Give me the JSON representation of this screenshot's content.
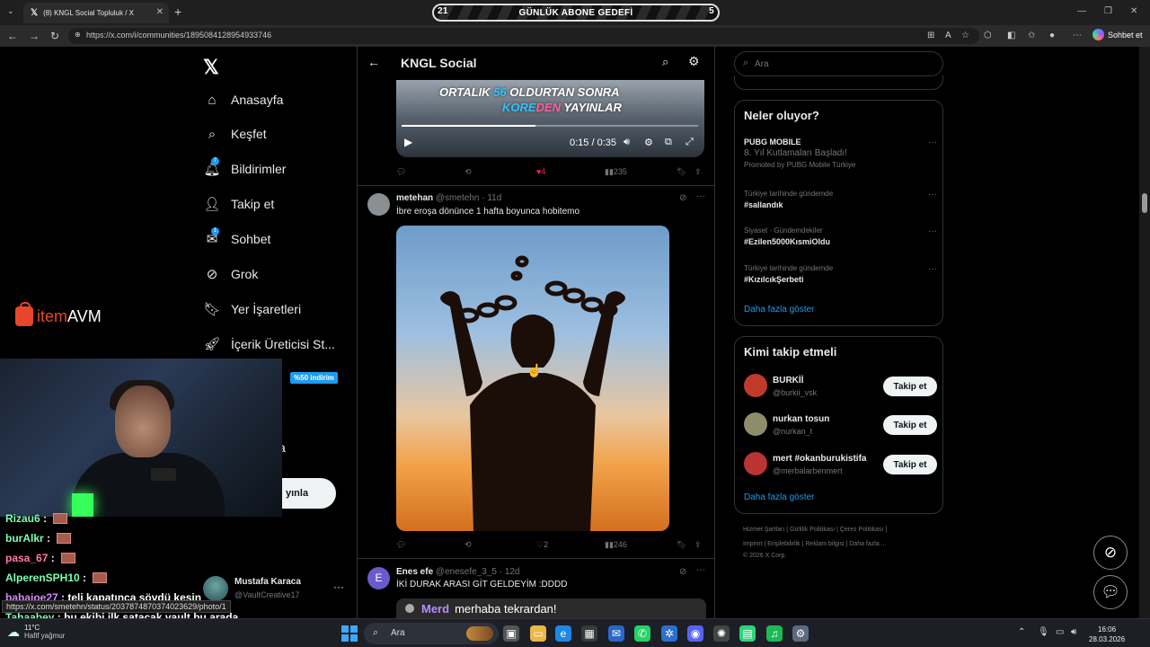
{
  "browser": {
    "tab_title": "(8) KNGL Social Topluluk / X",
    "url": "https://x.com/i/communities/1895084128954933746",
    "copilot_label": "Sohbet et"
  },
  "goal_bar": {
    "label": "GÜNLÜK ABONE GEDEFİ",
    "current": "21",
    "target": "5"
  },
  "nav": {
    "items": [
      {
        "label": "Anasayfa",
        "icon": "home-icon"
      },
      {
        "label": "Keşfet",
        "icon": "search-icon"
      },
      {
        "label": "Bildirimler",
        "icon": "bell-icon",
        "badge": "7"
      },
      {
        "label": "Takip et",
        "icon": "add-person-icon"
      },
      {
        "label": "Sohbet",
        "icon": "mail-icon",
        "badge": "1"
      },
      {
        "label": "Grok",
        "icon": "grok-icon"
      },
      {
        "label": "Yer İşaretleri",
        "icon": "bookmark-icon"
      },
      {
        "label": "İçerik Üreticisi St...",
        "icon": "rocket-icon"
      }
    ],
    "discount_badge": "%50 indirim",
    "partial_item": "a",
    "post_button": "yınla"
  },
  "profile": {
    "name": "Mustafa Karaca",
    "handle": "@VaultCreative17"
  },
  "overlay": {
    "brand_prefix": "item",
    "brand_suffix": "AVM",
    "chat": [
      {
        "user": "Rizau6",
        "msg": "",
        "user_color": "#7cffb0",
        "emote": true
      },
      {
        "user": "burAlkr",
        "msg": "",
        "user_color": "#7cffb0",
        "emote": true
      },
      {
        "user": "pasa_67",
        "msg": "",
        "user_color": "#ff7aa8",
        "emote": true
      },
      {
        "user": "AlperenSPH10",
        "msg": "",
        "user_color": "#7cffb0",
        "emote": true
      },
      {
        "user": "babajoe27",
        "msg": "teli kapatınca sövdü kesin",
        "user_color": "#d58bff",
        "emote": false
      },
      {
        "user": "Tahaabey",
        "msg": "bu ekibi ilk satacak vault bu arada",
        "user_color": "#7cffb0",
        "emote": false
      }
    ],
    "status_url": "https://x.com/smetehn/status/2037874870374023629/photo/1"
  },
  "community": {
    "title": "KNGL Social",
    "video": {
      "line1_a": "ORTALIK ",
      "line1_hi": "56",
      "line1_b": " OLDURTAN SONRA",
      "line2_hi1": "KORE",
      "line2_hi2": "DEN",
      "line2_b": " YAYINLAR",
      "time": "0:15 / 0:35",
      "progress": 0.45
    },
    "post1_actions": {
      "likes": "4",
      "views": "235"
    },
    "post2": {
      "name": "metehan",
      "handle": "@smetehn",
      "age": "11d",
      "text": "İbre eroşa dönünce 1 hafta boyunca hobitemo",
      "likes": "2",
      "views": "246"
    },
    "post3": {
      "initial": "E",
      "name": "Enes efe",
      "handle": "@enesefe_3_5",
      "age": "12d",
      "text": "İKİ DURAK ARASI GİT GELDEYİM :DDDD",
      "card_name": "Merd",
      "card_text": "merhaba tekrardan!"
    }
  },
  "sidebar": {
    "search_placeholder": "Ara",
    "trends_title": "Neler oluyor?",
    "trends": [
      {
        "ctx": "",
        "tag": "PUBG MOBILE",
        "sub": "8. Yıl Kutlamaları Başladı!",
        "promo": "Promoted by PUBG Mobile Türkiye"
      },
      {
        "ctx": "Türkiye tarihinde gündemde",
        "tag": "#sallandık"
      },
      {
        "ctx": "Siyaset · Gündemdekiler",
        "tag": "#Ezilen5000KısmiOldu"
      },
      {
        "ctx": "Türkiye tarihinde gündemde",
        "tag": "#KızılcıkŞerbeti"
      }
    ],
    "show_more": "Daha fazla göster",
    "who_title": "Kimi takip etmeli",
    "who": [
      {
        "name": "BURKİİ",
        "handle": "@burkii_vsk",
        "color": "#c0392b"
      },
      {
        "name": "nurkan tosun",
        "handle": "@nurkan_t",
        "color": "#8d8d6a"
      },
      {
        "name": "mert #okanburukistifa",
        "handle": "@merbalarbenmert",
        "color": "#b33"
      }
    ],
    "follow_label": "Takip et",
    "footer_line1": "Hizmet Şartları  |  Gizlilik Politikası  |  Çerez Politikası  |",
    "footer_line2": "Imprint  |  Erişilebilirlik  |  Reklam bilgisi  |  Daha fazla ...",
    "footer_line3": "© 2026 X Corp."
  },
  "taskbar": {
    "temp": "11°C",
    "weather": "Hafif yağmur",
    "search": "Ara",
    "time": "16:06",
    "date": "28.03.2026"
  }
}
